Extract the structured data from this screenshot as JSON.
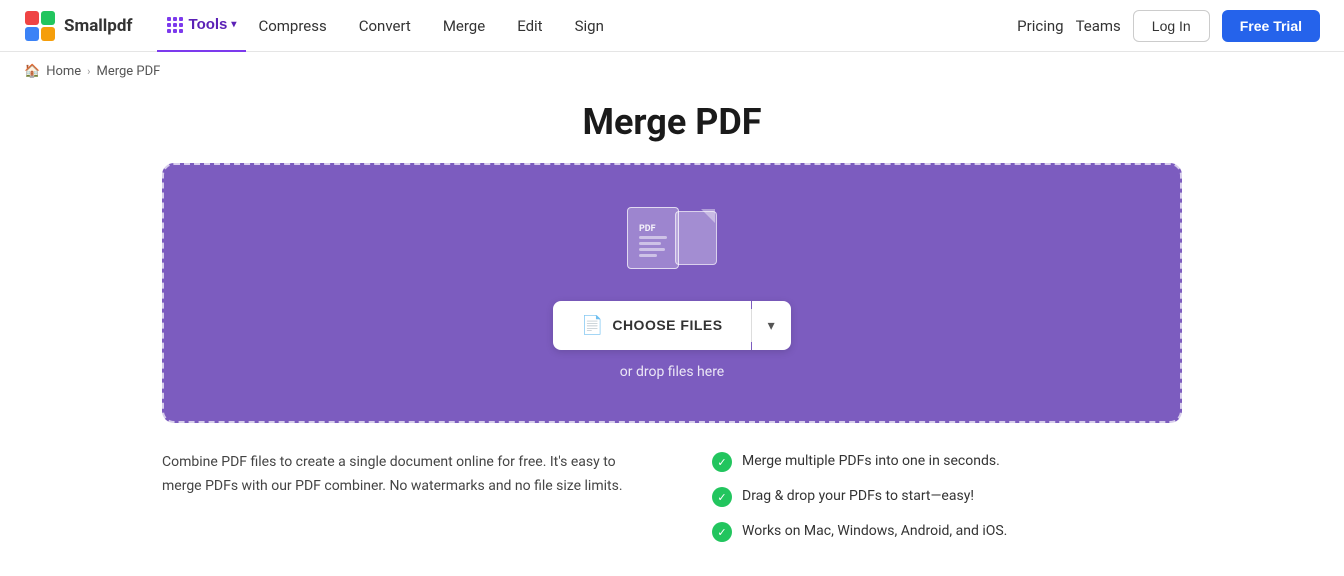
{
  "header": {
    "logo_text": "Smallpdf",
    "tools_label": "Tools",
    "nav": [
      {
        "label": "Compress",
        "id": "compress"
      },
      {
        "label": "Convert",
        "id": "convert"
      },
      {
        "label": "Merge",
        "id": "merge"
      },
      {
        "label": "Edit",
        "id": "edit"
      },
      {
        "label": "Sign",
        "id": "sign"
      }
    ],
    "pricing_label": "Pricing",
    "teams_label": "Teams",
    "login_label": "Log In",
    "free_trial_label": "Free Trial"
  },
  "breadcrumb": {
    "home": "Home",
    "current": "Merge PDF"
  },
  "main": {
    "title": "Merge PDF",
    "choose_files_label": "CHOOSE FILES",
    "drop_hint": "or drop files here"
  },
  "info": {
    "description": "Combine PDF files to create a single document online for free. It's easy to merge PDFs with our PDF combiner. No watermarks and no file size limits.",
    "features": [
      "Merge multiple PDFs into one in seconds.",
      "Drag & drop your PDFs to start—easy!",
      "Works on Mac, Windows, Android, and iOS."
    ]
  },
  "colors": {
    "accent": "#7c3aed",
    "drop_zone_bg": "#7c5cbf",
    "free_trial_bg": "#2563eb",
    "check_green": "#22c55e"
  }
}
